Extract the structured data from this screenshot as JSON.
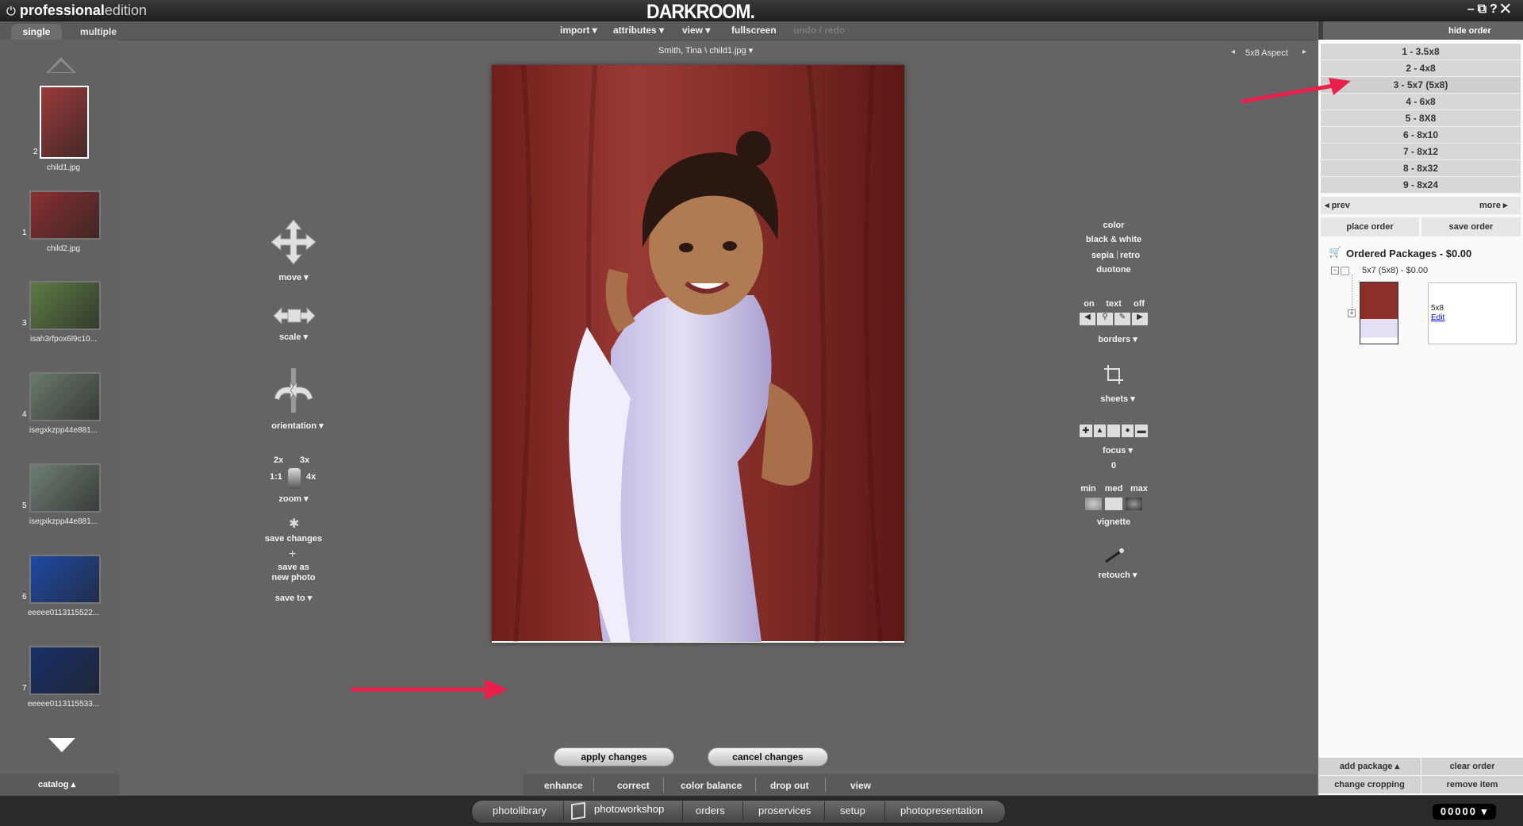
{
  "app": {
    "brand_bold": "professional",
    "brand_light": "edition",
    "logo": "DARKROOM.",
    "window_controls": "–⧉?✕"
  },
  "modes": {
    "single": "single",
    "multiple": "multiple"
  },
  "menus": {
    "import": "import ▾",
    "attributes": "attributes ▾",
    "view": "view ▾",
    "fullscreen": "fullscreen",
    "undo_redo": "undo / redo",
    "hide_order": "hide order"
  },
  "viewer": {
    "filename": "Smith, Tina \\ child1.jpg ▾",
    "aspect": "5x8  Aspect"
  },
  "thumbnails": [
    {
      "num": "2",
      "name": "child1.jpg",
      "color": "#9b3b3b",
      "selected": true
    },
    {
      "num": "1",
      "name": "child2.jpg",
      "color": "#8a3030",
      "selected": false
    },
    {
      "num": "3",
      "name": "isah3rfpox6l9c10...",
      "color": "#5e7a45",
      "selected": false
    },
    {
      "num": "4",
      "name": "isegxkzpp44e881...",
      "color": "#6a7a6a",
      "selected": false
    },
    {
      "num": "5",
      "name": "isegxkzpp44e881...",
      "color": "#6e7e72",
      "selected": false
    },
    {
      "num": "6",
      "name": "eeeee0113115522...",
      "color": "#1f4aa6",
      "selected": false
    },
    {
      "num": "7",
      "name": "eeeee0113115533...",
      "color": "#18306a",
      "selected": false
    }
  ],
  "catalog": "catalog ▴",
  "left_tools": {
    "move": "move ▾",
    "scale": "scale ▾",
    "orientation": "orientation ▾",
    "zoom_2x": "2x",
    "zoom_3x": "3x",
    "zoom_1x": "1:1",
    "zoom_4x": "4x",
    "zoom": "zoom ▾",
    "save_changes": "save changes",
    "save_new_1": "save as",
    "save_new_2": "new photo",
    "save_to": "save to ▾"
  },
  "right_tools": {
    "color": "color",
    "bw": "black & white",
    "sepia": "sepia",
    "retro": "retro",
    "duotone": "duotone",
    "on": "on",
    "text": "text",
    "off": "off",
    "borders": "borders ▾",
    "sheets": "sheets ▾",
    "focus": "focus ▾",
    "focus_value": "0",
    "min": "min",
    "med": "med",
    "max": "max",
    "vignette": "vignette",
    "retouch": "retouch ▾"
  },
  "actions": {
    "apply": "apply  changes",
    "cancel": "cancel  changes"
  },
  "bottom_tools": [
    "enhance",
    "correct",
    "color balance",
    "drop out",
    "view"
  ],
  "nav": [
    "photolibrary",
    "photoworkshop",
    "orders",
    "proservices",
    "setup",
    "photopresentation"
  ],
  "counter": "00000 ▾",
  "packages": [
    "1 - 3.5x8",
    "2 - 4x8",
    "3 - 5x7 (5x8)",
    "4 - 6x8",
    "5 - 8X8",
    "6 - 8x10",
    "7 - 8x12",
    "8 - 8x32",
    "9 - 8x24"
  ],
  "package_nav": {
    "prev": "◂ prev",
    "more": "more ▸"
  },
  "order_buttons": {
    "place": "place order",
    "save": "save order"
  },
  "ordered": {
    "title": "Ordered Packages - $0.00",
    "item": "5x7 (5x8) - $0.00",
    "size": "5x8",
    "edit": "Edit"
  },
  "order_footer": {
    "add": "add package ▴",
    "clear": "clear order",
    "crop": "change cropping",
    "remove": "remove item"
  },
  "colors": {
    "accent_arrow": "#e8204a",
    "backdrop": "#8c2e2a",
    "dress": "#d9d3ee"
  }
}
